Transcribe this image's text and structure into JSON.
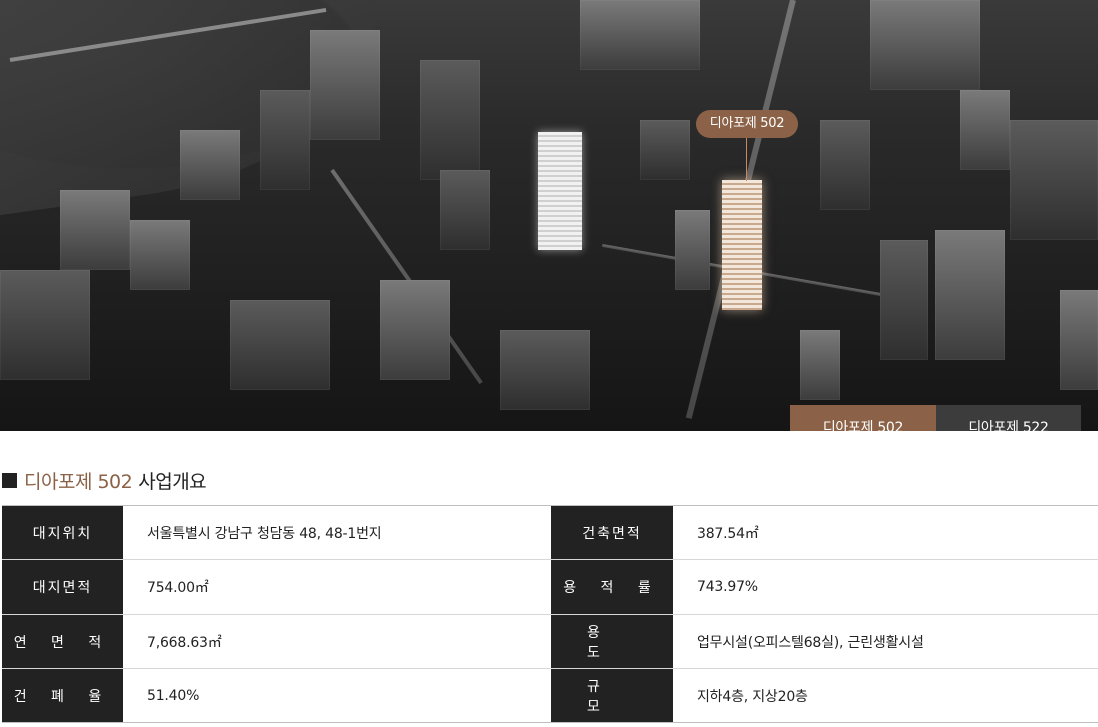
{
  "hero": {
    "callout_label": "디아포제 502"
  },
  "tabs": [
    {
      "label": "디아포제 502",
      "active": true
    },
    {
      "label": "디아포제 522",
      "active": false
    }
  ],
  "section": {
    "title_accent": "디아포제 502",
    "title_rest": "사업개요"
  },
  "info_rows": [
    {
      "left_label": "대지위치",
      "left_value": "서울특별시 강남구 청담동 48, 48-1번지",
      "right_label": "건축면적",
      "right_value": "387.54㎡"
    },
    {
      "left_label": "대지면적",
      "left_value": "754.00㎡",
      "right_label": "용 적 률",
      "right_value": "743.97%"
    },
    {
      "left_label": "연 면 적",
      "left_value": "7,668.63㎡",
      "right_label": "용 도",
      "right_value": "업무시설(오피스텔68실), 근린생활시설"
    },
    {
      "left_label": "건 폐 율",
      "left_value": "51.40%",
      "right_label": "규 모",
      "right_value": "지하4층, 지상20층"
    }
  ],
  "colors": {
    "accent": "#8b6247",
    "dark": "#222222",
    "tab_inactive": "#3c3c3c"
  }
}
